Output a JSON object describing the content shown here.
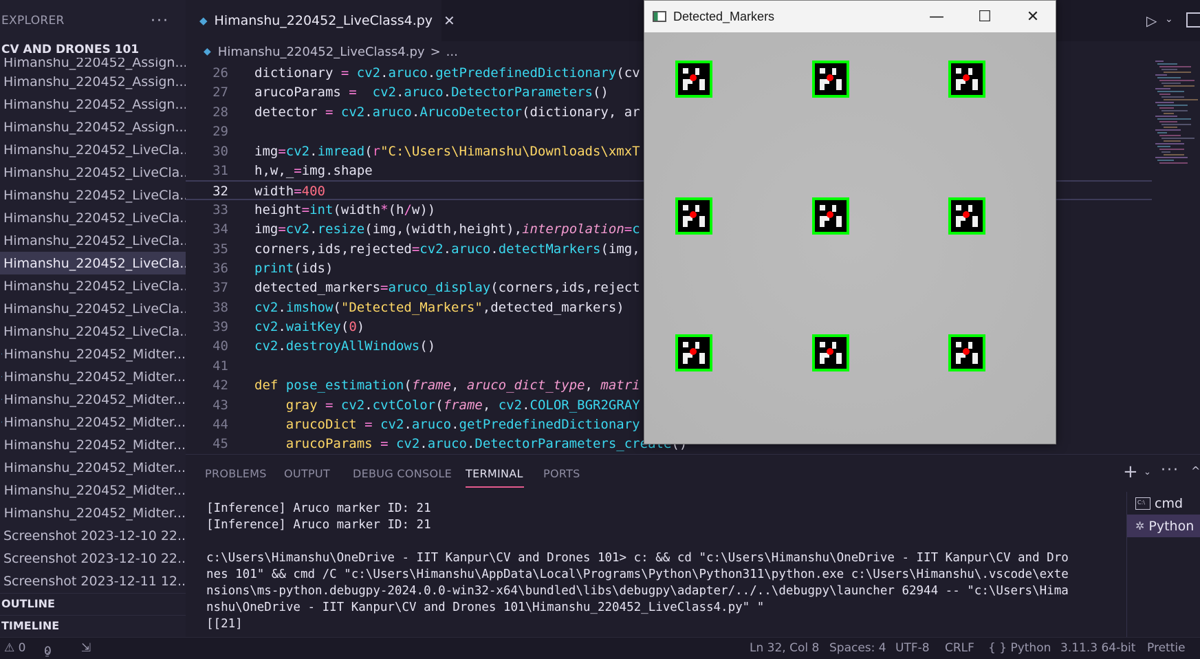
{
  "sidebar": {
    "title": "EXPLORER",
    "more": "···",
    "folder": "CV AND DRONES 101",
    "cut_item": "Himanshu_220452_Assign...",
    "files": [
      {
        "label": "Himanshu_220452_Assign...",
        "type": "img"
      },
      {
        "label": "Himanshu_220452_Assign...",
        "type": "img"
      },
      {
        "label": "Himanshu_220452_Assign...",
        "type": "img"
      },
      {
        "label": "Himanshu_220452_LiveCla...",
        "type": "py"
      },
      {
        "label": "Himanshu_220452_LiveCla...",
        "type": "py"
      },
      {
        "label": "Himanshu_220452_LiveCla...",
        "type": "py"
      },
      {
        "label": "Himanshu_220452_LiveCla...",
        "type": "py"
      },
      {
        "label": "Himanshu_220452_LiveCla...",
        "type": "py"
      },
      {
        "label": "Himanshu_220452_LiveCla...",
        "type": "py",
        "active": true
      },
      {
        "label": "Himanshu_220452_LiveCla...",
        "type": "img"
      },
      {
        "label": "Himanshu_220452_LiveCla...",
        "type": "img"
      },
      {
        "label": "Himanshu_220452_LiveCla...",
        "type": "img"
      },
      {
        "label": "Himanshu_220452_Midter...",
        "type": "py"
      },
      {
        "label": "Himanshu_220452_Midter...",
        "type": "py"
      },
      {
        "label": "Himanshu_220452_Midter...",
        "type": "py"
      },
      {
        "label": "Himanshu_220452_Midter...",
        "type": "py"
      },
      {
        "label": "Himanshu_220452_Midter...",
        "type": "img"
      },
      {
        "label": "Himanshu_220452_Midter...",
        "type": "img"
      },
      {
        "label": "Himanshu_220452_Midter...",
        "type": "img"
      },
      {
        "label": "Himanshu_220452_Midter...",
        "type": "img"
      },
      {
        "label": "Screenshot 2023-12-10 22...",
        "type": "img"
      },
      {
        "label": "Screenshot 2023-12-10 22...",
        "type": "img"
      },
      {
        "label": "Screenshot 2023-12-11 12...",
        "type": "img"
      }
    ],
    "outline": "OUTLINE",
    "timeline": "TIMELINE"
  },
  "editor": {
    "tab_label": "Himanshu_220452_LiveClass4.py",
    "tab_close": "✕",
    "breadcrumb_file": "Himanshu_220452_LiveClass4.py",
    "breadcrumb_sep": ">",
    "breadcrumb_more": "...",
    "current_line": "32",
    "lines": [
      {
        "n": "26",
        "html": "<span class='b'>dictionary</span> <span class='o'>=</span> <span class='f'>cv2</span>.<span class='f'>aruco</span>.<span class='f'>getPredefinedDictionary</span>(<span class='b'>cv</span>"
      },
      {
        "n": "27",
        "html": "<span class='b'>arucoParams</span> <span class='o'>=</span>  <span class='f'>cv2</span>.<span class='f'>aruco</span>.<span class='f'>DetectorParameters</span>()"
      },
      {
        "n": "28",
        "html": "<span class='b'>detector</span> <span class='o'>=</span> <span class='f'>cv2</span>.<span class='f'>aruco</span>.<span class='f'>ArucoDetector</span>(<span class='b'>dictionary</span>, <span class='b'>ar</span>"
      },
      {
        "n": "29",
        "html": ""
      },
      {
        "n": "30",
        "html": "<span class='b'>img</span><span class='o'>=</span><span class='f'>cv2</span>.<span class='f'>imread</span>(<span class='k'>r</span><span class='s'>\"C:\\Users\\Himanshu\\Downloads\\xmxT</span>"
      },
      {
        "n": "31",
        "html": "<span class='b'>h</span>,<span class='b'>w</span>,<span class='b'>_</span><span class='o'>=</span><span class='b'>img</span>.<span class='b'>shape</span>"
      },
      {
        "n": "32",
        "html": "<span class='b'>width</span><span class='o'>=</span><span class='n'>400</span>"
      },
      {
        "n": "33",
        "html": "<span class='b'>height</span><span class='o'>=</span><span class='f'>int</span>(<span class='b'>width</span><span class='o'>*</span>(<span class='b'>h</span><span class='o'>/</span><span class='b'>w</span>))"
      },
      {
        "n": "34",
        "html": "<span class='b'>img</span><span class='o'>=</span><span class='f'>cv2</span>.<span class='f'>resize</span>(<span class='b'>img</span>,(<span class='b'>width</span>,<span class='b'>height</span>),<span class='i'>interpolation</span><span class='o'>=</span><span class='f'>c</span>"
      },
      {
        "n": "35",
        "html": "<span class='b'>corners</span>,<span class='b'>ids</span>,<span class='b'>rejected</span><span class='o'>=</span><span class='f'>cv2</span>.<span class='f'>aruco</span>.<span class='f'>detectMarkers</span>(<span class='b'>img</span>,"
      },
      {
        "n": "36",
        "html": "<span class='f'>print</span>(<span class='b'>ids</span>)"
      },
      {
        "n": "37",
        "html": "<span class='b'>detected_markers</span><span class='o'>=</span><span class='f'>aruco_display</span>(<span class='b'>corners</span>,<span class='b'>ids</span>,<span class='b'>reject</span>"
      },
      {
        "n": "38",
        "html": "<span class='f'>cv2</span>.<span class='f'>imshow</span>(<span class='s'>\"Detected_Markers\"</span>,<span class='b'>detected_markers</span>)"
      },
      {
        "n": "39",
        "html": "<span class='f'>cv2</span>.<span class='f'>waitKey</span>(<span class='n'>0</span>)"
      },
      {
        "n": "40",
        "html": "<span class='f'>cv2</span>.<span class='f'>destroyAllWindows</span>()"
      },
      {
        "n": "41",
        "html": ""
      },
      {
        "n": "42",
        "html": "<span class='v'>def</span> <span class='f'>pose_estimation</span>(<span class='i'>frame</span>, <span class='i'>aruco_dict_type</span>, <span class='i'>matri</span>"
      },
      {
        "n": "43",
        "html": "    <span class='v'>gray</span> <span class='o'>=</span> <span class='f'>cv2</span>.<span class='f'>cvtColor</span>(<span class='i'>frame</span>, <span class='f'>cv2</span>.<span class='f'>COLOR_BGR2GRAY</span>"
      },
      {
        "n": "44",
        "html": "    <span class='v'>arucoDict</span> <span class='o'>=</span> <span class='f'>cv2</span>.<span class='f'>aruco</span>.<span class='f'>getPredefinedDictionary</span>"
      },
      {
        "n": "45",
        "html": "    <span class='v'>arucoParams</span> <span class='o'>=</span> <span class='f'>cv2</span>.<span class='f'>aruco</span>.<span class='f'>DetectorParameters_create</span>()"
      }
    ]
  },
  "cv_window": {
    "title": "Detected_Markers",
    "minimize": "—",
    "maximize": "☐",
    "close": "✕",
    "marker_count": 9,
    "colors": {
      "border": "#00ff00",
      "center": "#ff0000",
      "marker": "#000000"
    }
  },
  "panel": {
    "tabs": [
      "PROBLEMS",
      "OUTPUT",
      "DEBUG CONSOLE",
      "TERMINAL",
      "PORTS"
    ],
    "active_tab": "TERMINAL",
    "plus": "+",
    "chevron": "⌄",
    "more": "···",
    "up": "^",
    "terminal_text": "[Inference] Aruco marker ID: 21\n[Inference] Aruco marker ID: 21\n\nc:\\Users\\Himanshu\\OneDrive - IIT Kanpur\\CV and Drones 101> c: && cd \"c:\\Users\\Himanshu\\OneDrive - IIT Kanpur\\CV and Dro\nnes 101\" && cmd /C \"c:\\Users\\Himanshu\\AppData\\Local\\Programs\\Python\\Python311\\python.exe c:\\Users\\Himanshu\\.vscode\\exte\nnsions\\ms-python.debugpy-2024.0.0-win32-x64\\bundled\\libs\\debugpy\\adapter/../..\\debugpy\\launcher 62944 -- \"c:\\Users\\Hima\nnshu\\OneDrive - IIT Kanpur\\CV and Drones 101\\Himanshu_220452_LiveClass4.py\" \"\n[[21]",
    "terminals": [
      {
        "label": "cmd",
        "icon": "terminal-icon"
      },
      {
        "label": "Python",
        "icon": "debug-icon",
        "active": true
      }
    ]
  },
  "status": {
    "errors": "⚠ 0",
    "ports": "0",
    "position": "Ln 32, Col 8",
    "spaces": "Spaces: 4",
    "encoding": "UTF-8",
    "eol": "CRLF",
    "language": "{ } Python",
    "interpreter": "3.11.3 64-bit",
    "prettier": "Prettie"
  }
}
